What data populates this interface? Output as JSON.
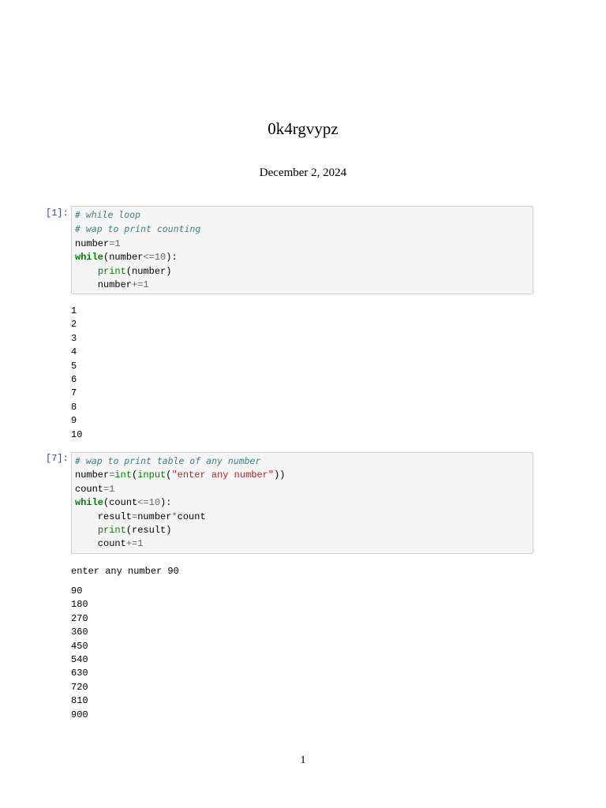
{
  "title": "0k4rgvypz",
  "date": "December 2, 2024",
  "page_number": "1",
  "cells": [
    {
      "prompt": "[1]:",
      "code": [
        [
          {
            "t": "# while loop",
            "c": "com"
          }
        ],
        [
          {
            "t": "# wap to print counting",
            "c": "com"
          }
        ],
        [
          {
            "t": "number"
          },
          {
            "t": "=",
            "c": "op"
          },
          {
            "t": "1",
            "c": "num"
          }
        ],
        [
          {
            "t": "while",
            "c": "kw"
          },
          {
            "t": "(number"
          },
          {
            "t": "<=",
            "c": "op"
          },
          {
            "t": "10",
            "c": "num"
          },
          {
            "t": "):"
          }
        ],
        [
          {
            "t": "    "
          },
          {
            "t": "print",
            "c": "bi"
          },
          {
            "t": "(number)"
          }
        ],
        [
          {
            "t": "    number"
          },
          {
            "t": "+=",
            "c": "op"
          },
          {
            "t": "1",
            "c": "num"
          }
        ]
      ],
      "output": [
        "1",
        "2",
        "3",
        "4",
        "5",
        "6",
        "7",
        "8",
        "9",
        "10"
      ]
    },
    {
      "prompt": "[7]:",
      "code": [
        [
          {
            "t": "# wap to print table of any number",
            "c": "com"
          }
        ],
        [
          {
            "t": "number"
          },
          {
            "t": "=",
            "c": "op"
          },
          {
            "t": "int",
            "c": "bi"
          },
          {
            "t": "("
          },
          {
            "t": "input",
            "c": "bi"
          },
          {
            "t": "("
          },
          {
            "t": "\"enter any number\"",
            "c": "str"
          },
          {
            "t": "))"
          }
        ],
        [
          {
            "t": "count"
          },
          {
            "t": "=",
            "c": "op"
          },
          {
            "t": "1",
            "c": "num"
          }
        ],
        [
          {
            "t": "while",
            "c": "kw"
          },
          {
            "t": "(count"
          },
          {
            "t": "<=",
            "c": "op"
          },
          {
            "t": "10",
            "c": "num"
          },
          {
            "t": "):"
          }
        ],
        [
          {
            "t": "    result"
          },
          {
            "t": "=",
            "c": "op"
          },
          {
            "t": "number"
          },
          {
            "t": "*",
            "c": "op"
          },
          {
            "t": "count"
          }
        ],
        [
          {
            "t": "    "
          },
          {
            "t": "print",
            "c": "bi"
          },
          {
            "t": "(result)"
          }
        ],
        [
          {
            "t": "    count"
          },
          {
            "t": "+=",
            "c": "op"
          },
          {
            "t": "1",
            "c": "num"
          }
        ]
      ],
      "stdin_prompt": "enter any number 90",
      "output": [
        "90",
        "180",
        "270",
        "360",
        "450",
        "540",
        "630",
        "720",
        "810",
        "900"
      ]
    }
  ]
}
